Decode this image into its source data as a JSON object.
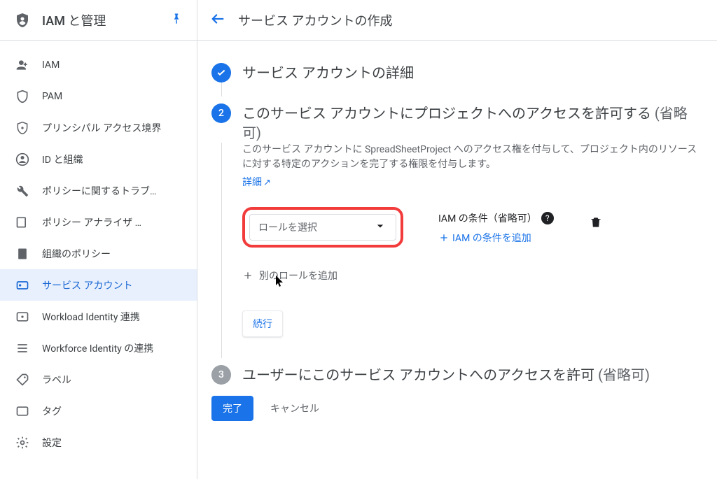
{
  "sidebar": {
    "title": "IAM と管理",
    "items": [
      {
        "label": "IAM",
        "icon": "person-add"
      },
      {
        "label": "PAM",
        "icon": "shield"
      },
      {
        "label": "プリンシパル アクセス境界",
        "icon": "shield-lock"
      },
      {
        "label": "ID と組織",
        "icon": "account"
      },
      {
        "label": "ポリシーに関するトラブ…",
        "icon": "wrench"
      },
      {
        "label": "ポリシー アナライザ …",
        "icon": "analyzer"
      },
      {
        "label": "組織のポリシー",
        "icon": "document"
      },
      {
        "label": "サービス アカウント",
        "icon": "badge",
        "active": true
      },
      {
        "label": "Workload Identity 連携",
        "icon": "workload"
      },
      {
        "label": "Workforce Identity の連携",
        "icon": "workforce"
      },
      {
        "label": "ラベル",
        "icon": "tag"
      },
      {
        "label": "タグ",
        "icon": "flag"
      },
      {
        "label": "設定",
        "icon": "gear"
      }
    ]
  },
  "main": {
    "page_title": "サービス アカウントの作成",
    "step1_title": "サービス アカウントの詳細",
    "step2_title_a": "このサービス アカウントにプロジェクトへのアクセスを許可する",
    "step2_optional": " (省略可)",
    "step2_number": "2",
    "step2_desc": "このサービス アカウントに SpreadSheetProject へのアクセス権を付与して、プロジェクト内のリソースに対する特定のアクションを完了する権限を付与します。",
    "step2_details_link": "詳細",
    "role_select_placeholder": "ロールを選択",
    "iam_condition_label": "IAM の条件（省略可）",
    "add_condition_label": "IAM の条件を追加",
    "add_role_label": "別のロールを追加",
    "continue_label": "続行",
    "step3_number": "3",
    "step3_title": "ユーザーにこのサービス アカウントへのアクセスを許可",
    "step3_optional": " (省略可)",
    "done_label": "完了",
    "cancel_label": "キャンセル"
  }
}
